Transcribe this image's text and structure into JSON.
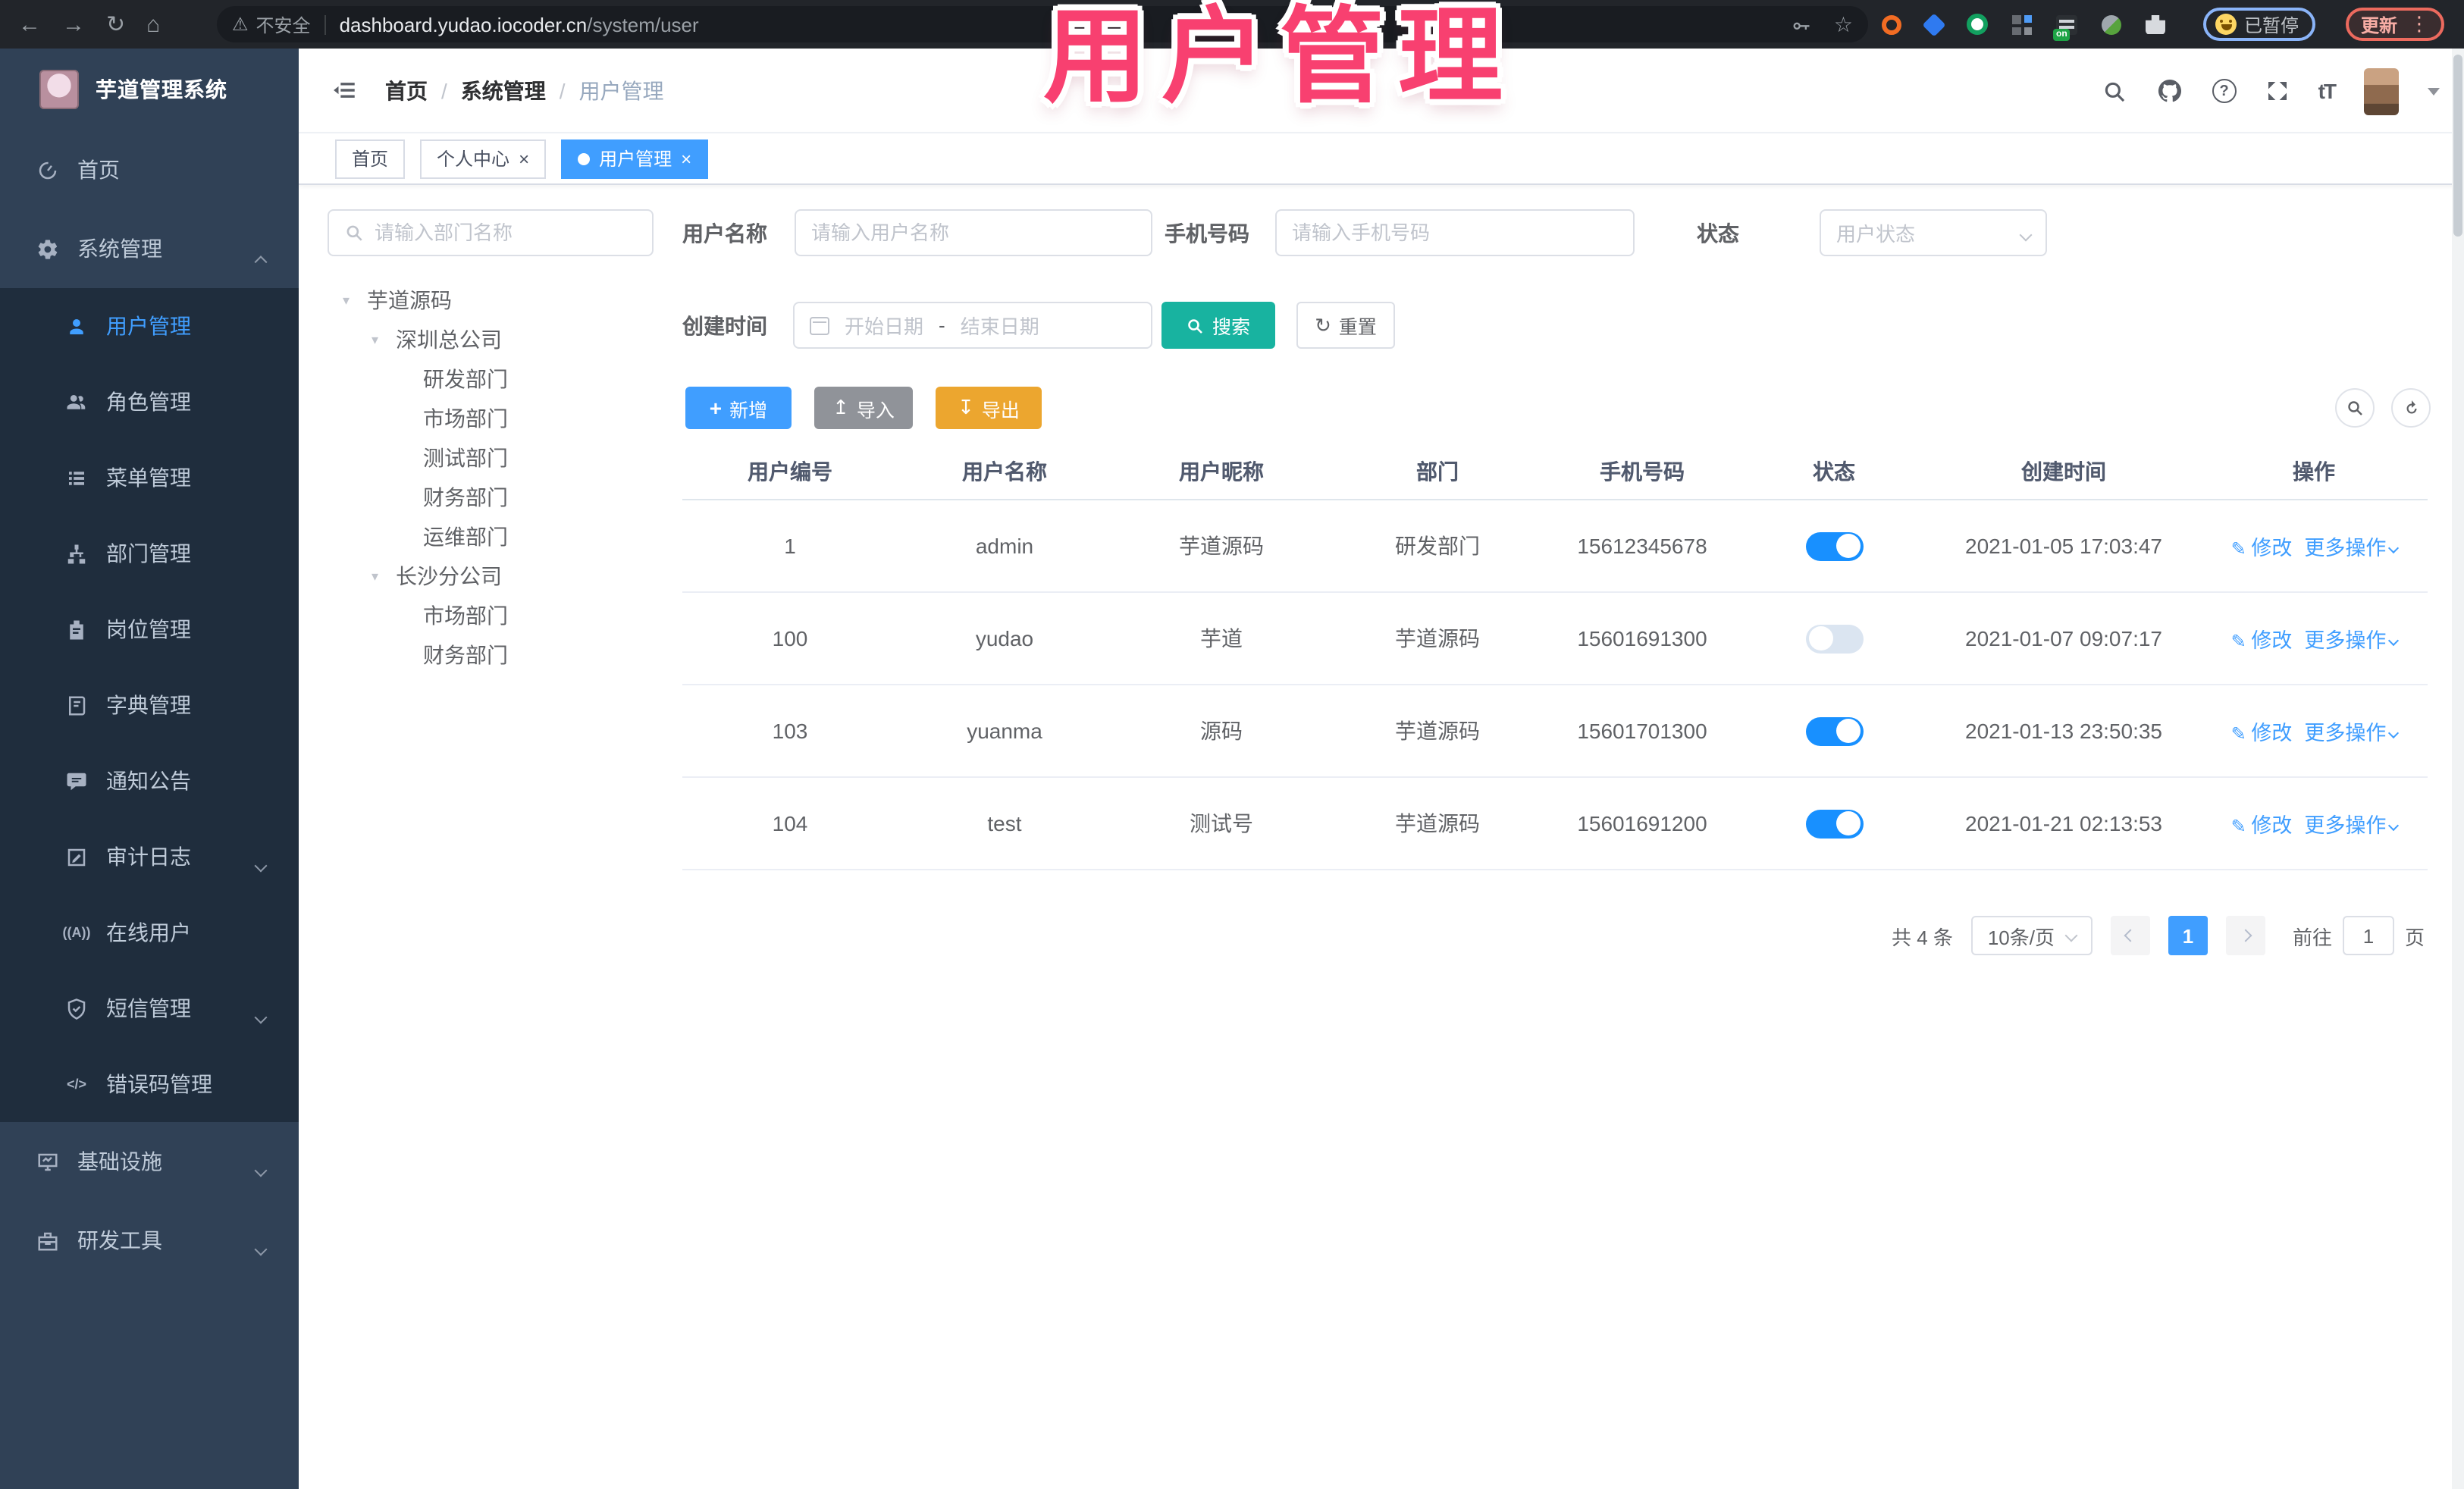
{
  "annotation": {
    "text": "用户管理"
  },
  "browser": {
    "security_label": "不安全",
    "url_domain": "dashboard.yudao.iocoder.cn",
    "url_path": "/system/user",
    "extension_badge": "on",
    "paused_label": "已暂停",
    "update_label": "更新"
  },
  "sidebar": {
    "title": "芋道管理系统",
    "items": [
      {
        "label": "首页"
      },
      {
        "label": "系统管理"
      },
      {
        "label": "用户管理"
      },
      {
        "label": "角色管理"
      },
      {
        "label": "菜单管理"
      },
      {
        "label": "部门管理"
      },
      {
        "label": "岗位管理"
      },
      {
        "label": "字典管理"
      },
      {
        "label": "通知公告"
      },
      {
        "label": "审计日志"
      },
      {
        "label": "在线用户"
      },
      {
        "label": "短信管理"
      },
      {
        "label": "错误码管理"
      },
      {
        "label": "基础设施"
      },
      {
        "label": "研发工具"
      }
    ]
  },
  "header": {
    "breadcrumb": {
      "home": "首页",
      "section": "系统管理",
      "current": "用户管理"
    }
  },
  "tabs": {
    "t0": "首页",
    "t1": "个人中心",
    "t2": "用户管理"
  },
  "tree": {
    "search_placeholder": "请输入部门名称",
    "nodes": [
      {
        "label": "芋道源码"
      },
      {
        "label": "深圳总公司"
      },
      {
        "label": "研发部门"
      },
      {
        "label": "市场部门"
      },
      {
        "label": "测试部门"
      },
      {
        "label": "财务部门"
      },
      {
        "label": "运维部门"
      },
      {
        "label": "长沙分公司"
      },
      {
        "label": "市场部门"
      },
      {
        "label": "财务部门"
      }
    ]
  },
  "filters": {
    "username_label": "用户名称",
    "username_placeholder": "请输入用户名称",
    "mobile_label": "手机号码",
    "mobile_placeholder": "请输入手机号码",
    "status_label": "状态",
    "status_placeholder": "用户状态",
    "create_time_label": "创建时间",
    "start_placeholder": "开始日期",
    "range_separator": "-",
    "end_placeholder": "结束日期",
    "search_label": "搜索",
    "reset_label": "重置"
  },
  "toolbar": {
    "add_label": "新增",
    "import_label": "导入",
    "export_label": "导出"
  },
  "table": {
    "columns": [
      "用户编号",
      "用户名称",
      "用户昵称",
      "部门",
      "手机号码",
      "状态",
      "创建时间",
      "操作"
    ],
    "edit_label": "修改",
    "more_label": "更多操作",
    "rows": [
      {
        "id": "1",
        "username": "admin",
        "nickname": "芋道源码",
        "dept": "研发部门",
        "mobile": "15612345678",
        "status": "on",
        "created": "2021-01-05 17:03:47"
      },
      {
        "id": "100",
        "username": "yudao",
        "nickname": "芋道",
        "dept": "芋道源码",
        "mobile": "15601691300",
        "status": "off",
        "created": "2021-01-07 09:07:17"
      },
      {
        "id": "103",
        "username": "yuanma",
        "nickname": "源码",
        "dept": "芋道源码",
        "mobile": "15601701300",
        "status": "on",
        "created": "2021-01-13 23:50:35"
      },
      {
        "id": "104",
        "username": "test",
        "nickname": "测试号",
        "dept": "芋道源码",
        "mobile": "15601691200",
        "status": "on",
        "created": "2021-01-21 02:13:53"
      }
    ]
  },
  "pagination": {
    "total_label": "共 4 条",
    "page_size_label": "10条/页",
    "current_page": "1",
    "goto_label": "前往",
    "goto_value": "1",
    "page_unit_label": "页"
  },
  "colors": {
    "primary": "#409eff",
    "search_teal": "#18b3a0",
    "export_orange": "#eca62f",
    "import_grey": "#909399",
    "annotation_pink": "#f84070",
    "sidebar_bg": "#304156",
    "submenu_bg": "#1f2d3d",
    "switch_on": "#1890ff",
    "switch_off": "#dbe5f1"
  }
}
